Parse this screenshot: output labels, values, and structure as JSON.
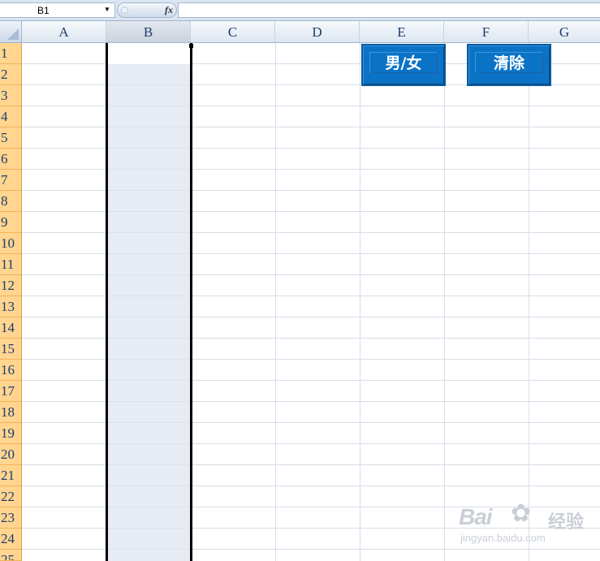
{
  "formula_bar": {
    "name_box": "B1",
    "fx_label": "fx",
    "formula_value": ""
  },
  "columns": [
    "A",
    "B",
    "C",
    "D",
    "E",
    "F",
    "G"
  ],
  "selected_column": "B",
  "rows": [
    "1",
    "2",
    "3",
    "4",
    "5",
    "6",
    "7",
    "8",
    "9",
    "10",
    "11",
    "12",
    "13",
    "14",
    "15",
    "16",
    "17",
    "18",
    "19",
    "20",
    "21",
    "22",
    "23",
    "24",
    "25"
  ],
  "buttons": {
    "gender": "男/女",
    "clear": "清除"
  },
  "colors": {
    "button_blue": "#0b73c6",
    "row_header_orange": "#ffd58f",
    "selection_fill": "#e7ebf4"
  },
  "watermark": {
    "brand": "Bai",
    "suffix": "经验",
    "url": "jingyan.baidu.com"
  }
}
